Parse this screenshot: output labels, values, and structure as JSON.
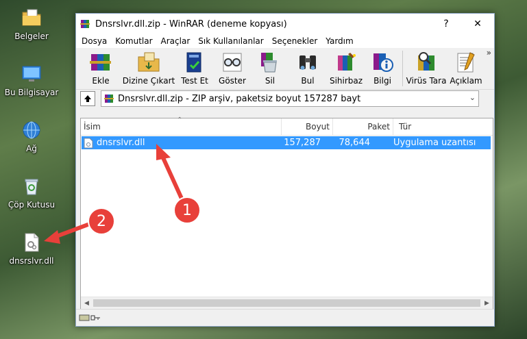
{
  "desktop": {
    "icons": [
      {
        "label": "Belgeler",
        "icon": "folder-icon"
      },
      {
        "label": "Bu Bilgisayar",
        "icon": "computer-icon"
      },
      {
        "label": "Ağ",
        "icon": "network-icon"
      },
      {
        "label": "Çöp Kutusu",
        "icon": "recycle-bin-icon"
      },
      {
        "label": "dnsrslvr.dll",
        "icon": "dll-file-icon"
      }
    ]
  },
  "window": {
    "title": "Dnsrslvr.dll.zip - WinRAR (deneme kopyası)",
    "controls": {
      "help": "?",
      "close": "✕"
    },
    "menu": [
      "Dosya",
      "Komutlar",
      "Araçlar",
      "Sık Kullanılanlar",
      "Seçenekler",
      "Yardım"
    ],
    "toolbar": [
      {
        "label": "Ekle",
        "icon": "books-add-icon"
      },
      {
        "label": "Dizine Çıkart",
        "icon": "extract-folder-icon"
      },
      {
        "label": "Test Et",
        "icon": "test-book-icon"
      },
      {
        "label": "Göster",
        "icon": "view-glasses-icon"
      },
      {
        "label": "Sil",
        "icon": "delete-icon"
      },
      {
        "label": "Bul",
        "icon": "binoculars-icon"
      },
      {
        "label": "Sihirbaz",
        "icon": "wizard-icon"
      },
      {
        "label": "Bilgi",
        "icon": "info-icon"
      },
      {
        "label": "Virüs Tara",
        "icon": "virus-scan-icon"
      },
      {
        "label": "Açıklam",
        "icon": "comment-icon"
      }
    ],
    "toolbar_more": "»",
    "address": "Dnsrslvr.dll.zip - ZIP arşiv, paketsiz boyut 157287 bayt",
    "columns": {
      "name": "İsim",
      "size": "Boyut",
      "packed": "Paket",
      "type": "Tür"
    },
    "files": [
      {
        "name": "dnsrslvr.dll",
        "size": "157,287",
        "packed": "78,644",
        "type": "Uygulama uzantısı"
      }
    ]
  },
  "callouts": {
    "one": "1",
    "two": "2"
  },
  "colors": {
    "selection": "#3399ff",
    "callout": "#e8403a"
  }
}
